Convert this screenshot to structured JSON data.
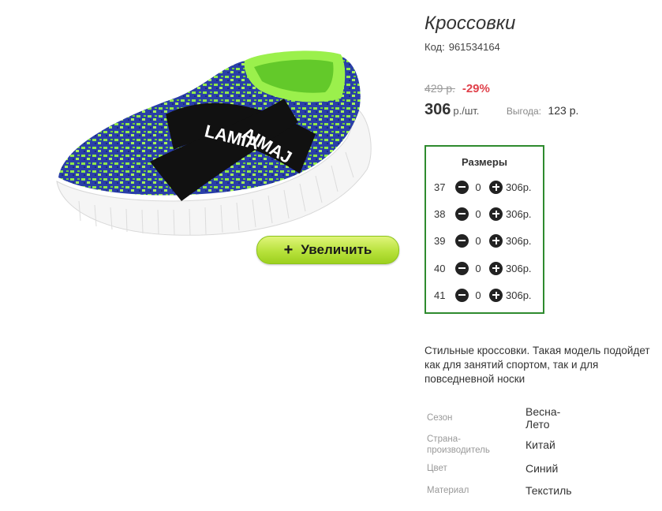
{
  "product": {
    "title": "Кроссовки",
    "code_label": "Код:",
    "code_value": "961534164",
    "old_price": "429 р.",
    "discount": "-29%",
    "price": "306",
    "price_unit": "р./шт.",
    "saving_label": "Выгода:",
    "saving_value": "123 р.",
    "zoom_button_label": "Увеличить",
    "zoom_button_icon": "+",
    "image_alt": "green-blue-sneaker",
    "colors": {
      "accent_green": "#2e8b2e",
      "button_green": "#b8e23c",
      "discount_red": "#e0404a"
    }
  },
  "sizes": {
    "title": "Размеры",
    "rows": [
      {
        "size": "37",
        "qty": "0",
        "price": "306р."
      },
      {
        "size": "38",
        "qty": "0",
        "price": "306р."
      },
      {
        "size": "39",
        "qty": "0",
        "price": "306р."
      },
      {
        "size": "40",
        "qty": "0",
        "price": "306р."
      },
      {
        "size": "41",
        "qty": "0",
        "price": "306р."
      }
    ]
  },
  "description": "Стильные кроссовки. Такая модель подойдет как для занятий спортом, так и для повседневной носки",
  "properties": [
    {
      "label": "Сезон",
      "value": "Весна-Лето"
    },
    {
      "label": "Страна-производитель",
      "value": "Китай"
    },
    {
      "label": "Цвет",
      "value": "Синий"
    },
    {
      "label": "Материал",
      "value": "Текстиль"
    }
  ]
}
